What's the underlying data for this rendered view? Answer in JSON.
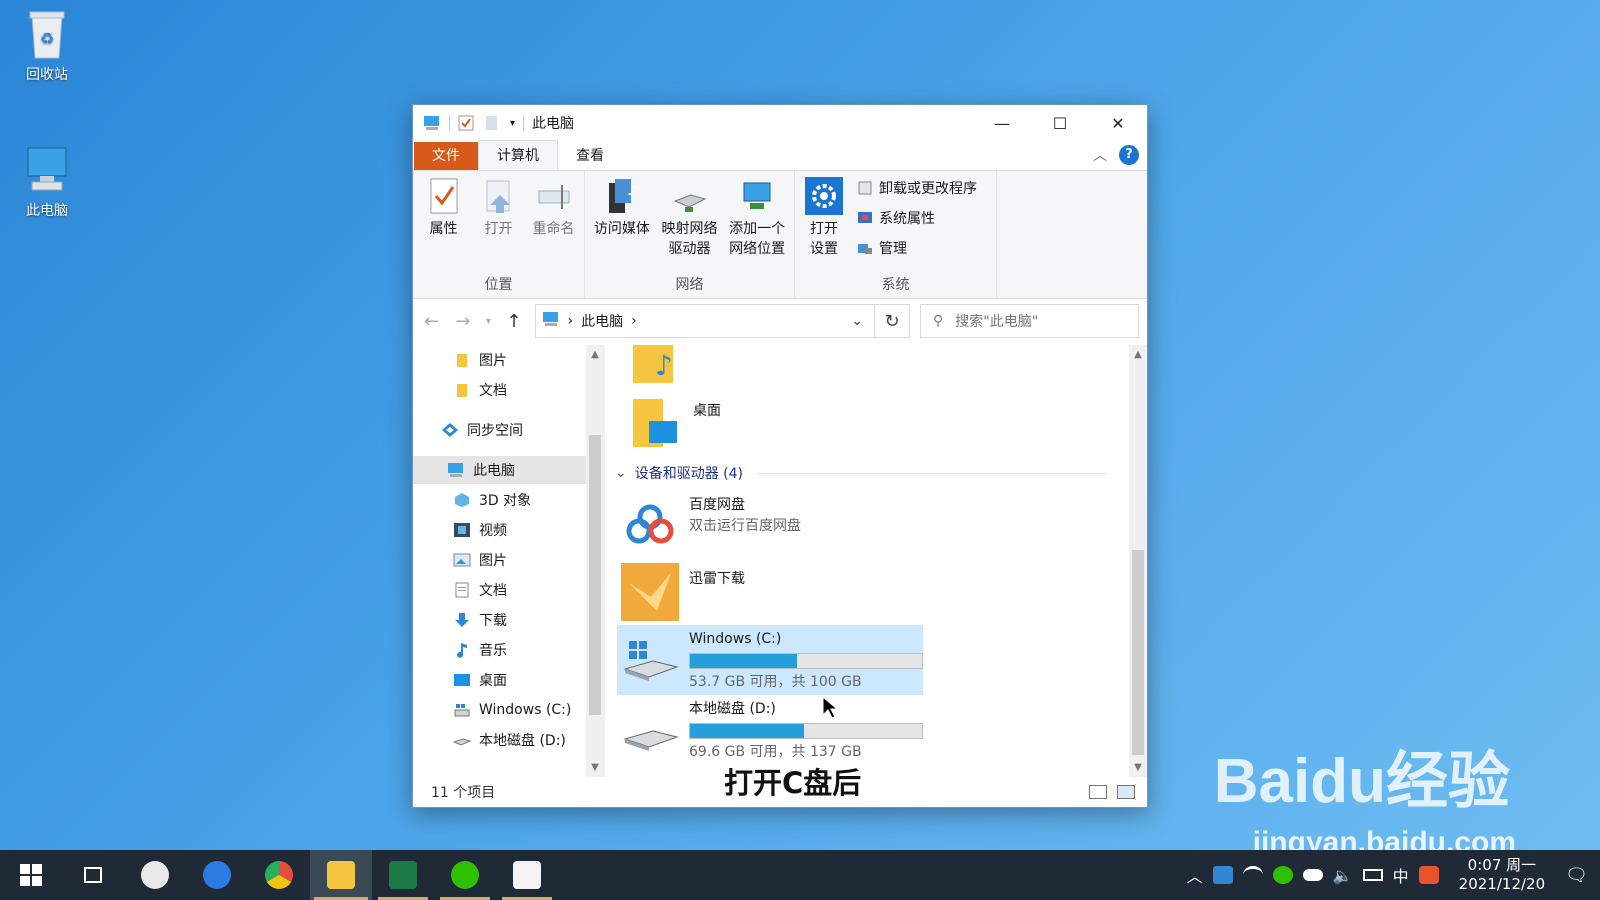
{
  "desktop": {
    "recycle_label": "回收站",
    "pc_label": "此电脑"
  },
  "window": {
    "title": "此电脑",
    "controls": {
      "minimize": "—",
      "maximize": "☐",
      "close": "✕"
    }
  },
  "ribbon_tabs": {
    "file": "文件",
    "computer": "计算机",
    "view": "查看"
  },
  "ribbon": {
    "location": {
      "label": "位置",
      "properties": "属性",
      "open": "打开",
      "rename": "重命名"
    },
    "network": {
      "label": "网络",
      "access_media": "访问媒体",
      "map_drive_1": "映射网络",
      "map_drive_2": "驱动器",
      "add_location_1": "添加一个",
      "add_location_2": "网络位置"
    },
    "system": {
      "label": "系统",
      "open_settings_1": "打开",
      "open_settings_2": "设置",
      "uninstall": "卸载或更改程序",
      "sys_props": "系统属性",
      "manage": "管理"
    }
  },
  "address": {
    "path": "此电脑",
    "search_placeholder": "搜索\"此电脑\""
  },
  "nav_pane": {
    "items": [
      {
        "label": "图片"
      },
      {
        "label": "文档"
      },
      {
        "label": "同步空间"
      },
      {
        "label": "此电脑"
      },
      {
        "label": "3D 对象"
      },
      {
        "label": "视频"
      },
      {
        "label": "图片"
      },
      {
        "label": "文档"
      },
      {
        "label": "下载"
      },
      {
        "label": "音乐"
      },
      {
        "label": "桌面"
      },
      {
        "label": "Windows (C:)"
      },
      {
        "label": "本地磁盘 (D:)"
      }
    ]
  },
  "content": {
    "desktop_folder": "桌面",
    "devices_header": "设备和驱动器 (4)",
    "baidu": {
      "name": "百度网盘",
      "sub": "双击运行百度网盘"
    },
    "xunlei": {
      "name": "迅雷下载"
    },
    "drive_c": {
      "name": "Windows (C:)",
      "info": "53.7 GB 可用，共 100 GB",
      "used_fraction": 0.463
    },
    "drive_d": {
      "name": "本地磁盘 (D:)",
      "info": "69.6 GB 可用，共 137 GB",
      "used_fraction": 0.492
    }
  },
  "status": {
    "item_count": "11 个项目"
  },
  "caption": "打开C盘后",
  "watermark": {
    "brand": "Baidu经验",
    "url": "jingyan.baidu.com"
  },
  "taskbar": {
    "clock_time": "0:07 周一",
    "clock_date": "2021/12/20",
    "ime": "中"
  }
}
